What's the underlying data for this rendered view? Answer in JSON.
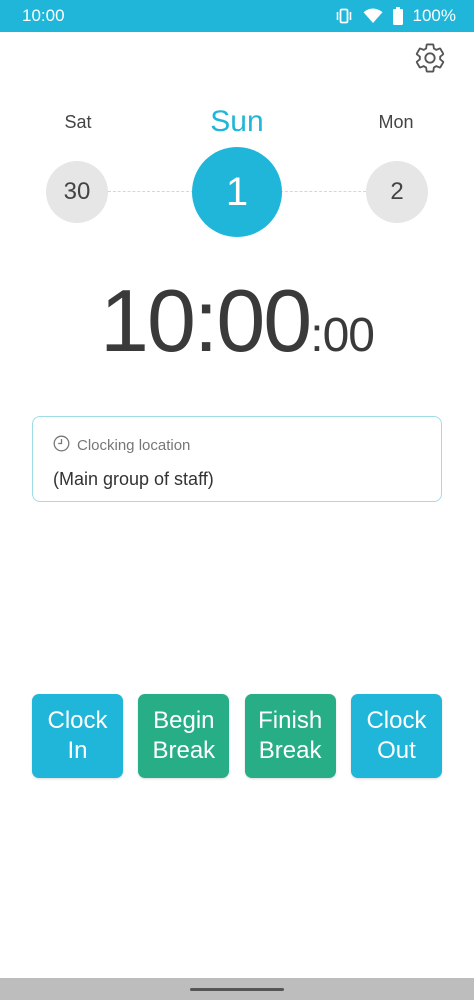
{
  "status_bar": {
    "time": "10:00",
    "battery": "100%",
    "icons": [
      "vibrate-icon",
      "wifi-icon",
      "battery-icon"
    ]
  },
  "header": {
    "settings_icon": "gear-icon"
  },
  "days": {
    "prev": {
      "name": "Sat",
      "number": "30"
    },
    "current": {
      "name": "Sun",
      "number": "1"
    },
    "next": {
      "name": "Mon",
      "number": "2"
    }
  },
  "clock": {
    "hours_minutes": "10:00",
    "seconds": ":00"
  },
  "location": {
    "title": "Clocking location",
    "value": "(Main group of staff)"
  },
  "actions": {
    "clock_in": "Clock In",
    "begin_break": "Begin Break",
    "finish_break": "Finish Break",
    "clock_out": "Clock Out"
  },
  "colors": {
    "accent": "#1fb6d9",
    "break": "#27ae87",
    "text": "#3a3a3a"
  }
}
